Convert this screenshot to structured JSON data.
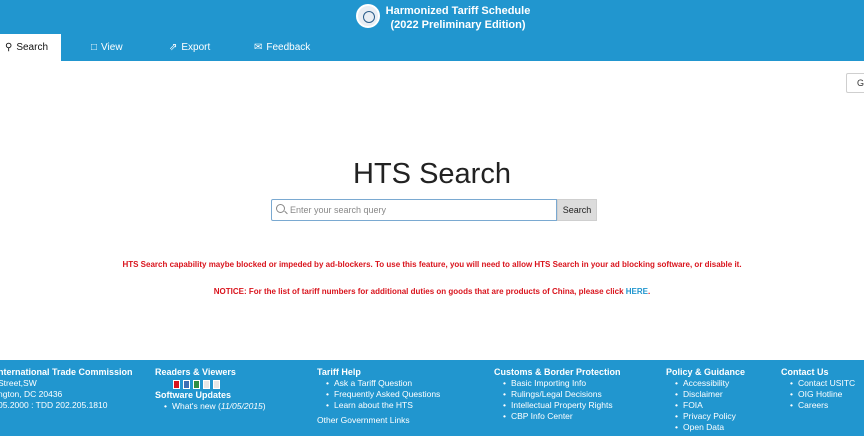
{
  "header": {
    "title_line1": "Harmonized Tariff Schedule",
    "title_line2": "(2022 Preliminary Edition)"
  },
  "nav": {
    "tabs": [
      {
        "label": "Search",
        "icon": "search-icon",
        "active": true
      },
      {
        "label": "View",
        "icon": "document-icon",
        "active": false
      },
      {
        "label": "Export",
        "icon": "export-icon",
        "active": false
      },
      {
        "label": "Feedback",
        "icon": "chat-icon",
        "active": false
      }
    ]
  },
  "corner_button": {
    "label": "G"
  },
  "search": {
    "title": "HTS Search",
    "placeholder": "Enter your search query",
    "button_label": "Search"
  },
  "notices": {
    "adblock": "HTS Search capability maybe blocked or impeded by ad-blockers. To use this feature, you will need to allow HTS Search in your ad blocking software, or disable it.",
    "china_prefix": "NOTICE: For the list of tariff numbers for additional duties on goods that are products of China, please click ",
    "china_link": "HERE",
    "china_suffix": "."
  },
  "footer": {
    "commission": {
      "heading": "nternational Trade Commission",
      "lines": [
        "Street,SW",
        "ngton, DC 20436",
        "05.2000 : TDD 202.205.1810"
      ]
    },
    "readers": {
      "heading": "Readers & Viewers",
      "updates_heading": "Software Updates",
      "updates_item_prefix": "What's new (",
      "updates_item_date": "11/05/2015",
      "updates_item_suffix": ")"
    },
    "tariff_help": {
      "heading": "Tariff Help",
      "items": [
        "Ask a Tariff Question",
        "Frequently Asked Questions",
        "Learn about the HTS"
      ],
      "other_links": "Other Government Links"
    },
    "customs": {
      "heading": "Customs & Border Protection",
      "items": [
        "Basic Importing Info",
        "Rulings/Legal Decisions",
        "Intellectual Property Rights",
        "CBP Info Center"
      ]
    },
    "policy": {
      "heading": "Policy & Guidance",
      "items": [
        "Accessibility",
        "Disclaimer",
        "FOIA",
        "Privacy Policy",
        "Open Data"
      ]
    },
    "contact": {
      "heading": "Contact Us",
      "items": [
        "Contact USITC",
        "OIG Hotline",
        "Careers"
      ]
    }
  },
  "colors": {
    "brand_blue": "#2196cf",
    "notice_red": "#d9141d"
  }
}
